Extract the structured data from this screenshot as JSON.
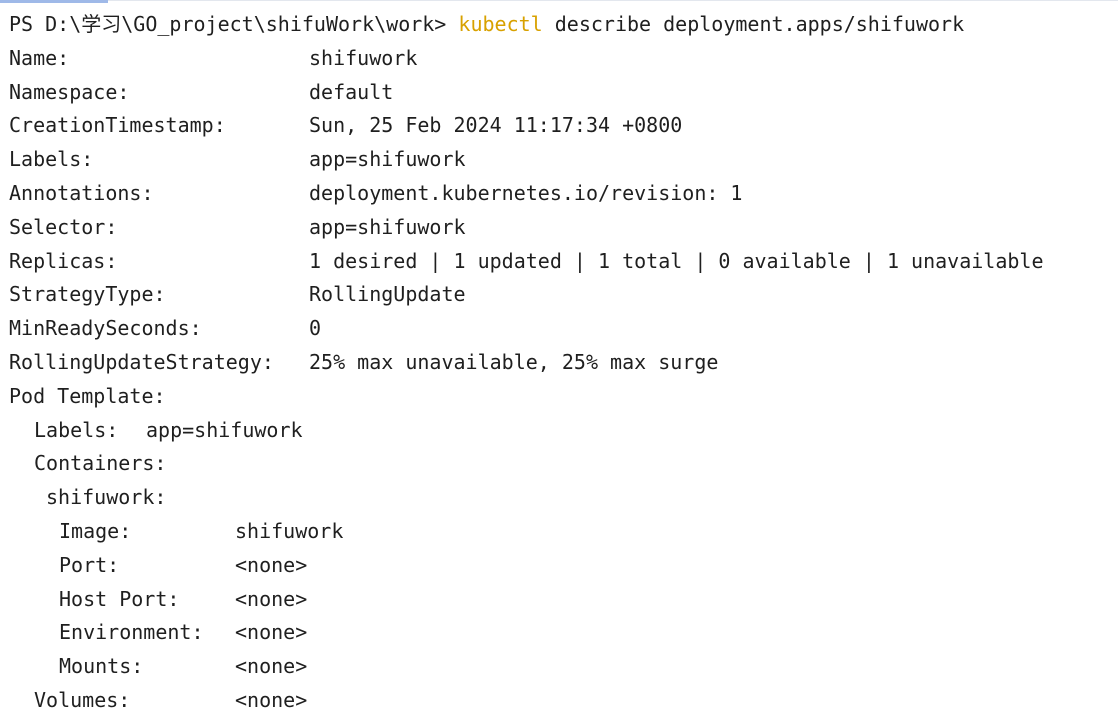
{
  "prompt": {
    "prefix": "PS D:\\学习\\GO_project\\shifuWork\\work> ",
    "command_keyword": "kubectl",
    "command_rest": " describe deployment.apps/shifuwork",
    "keyword_color": "#d8a100"
  },
  "fields": [
    {
      "key": "Name:",
      "value": "shifuwork"
    },
    {
      "key": "Namespace:",
      "value": "default"
    },
    {
      "key": "CreationTimestamp:",
      "value": "Sun, 25 Feb 2024 11:17:34 +0800"
    },
    {
      "key": "Labels:",
      "value": "app=shifuwork"
    },
    {
      "key": "Annotations:",
      "value": "deployment.kubernetes.io/revision: 1"
    },
    {
      "key": "Selector:",
      "value": "app=shifuwork"
    },
    {
      "key": "Replicas:",
      "value": "1 desired | 1 updated | 1 total | 0 available | 1 unavailable"
    },
    {
      "key": "StrategyType:",
      "value": "RollingUpdate"
    },
    {
      "key": "MinReadySeconds:",
      "value": "0"
    },
    {
      "key": "RollingUpdateStrategy:",
      "value": "25% max unavailable, 25% max surge"
    }
  ],
  "pod_template": {
    "heading": "Pod Template:",
    "labels_key": "Labels:",
    "labels_value": "app=shifuwork",
    "containers_key": "Containers:",
    "container_name": "shifuwork:",
    "container_fields": [
      {
        "key": "Image:",
        "value": "shifuwork"
      },
      {
        "key": "Port:",
        "value": "<none>"
      },
      {
        "key": "Host Port:",
        "value": "<none>"
      },
      {
        "key": "Environment:",
        "value": "<none>"
      },
      {
        "key": "Mounts:",
        "value": "<none>"
      }
    ],
    "volumes_key": "Volumes:",
    "volumes_value": "<none>"
  }
}
